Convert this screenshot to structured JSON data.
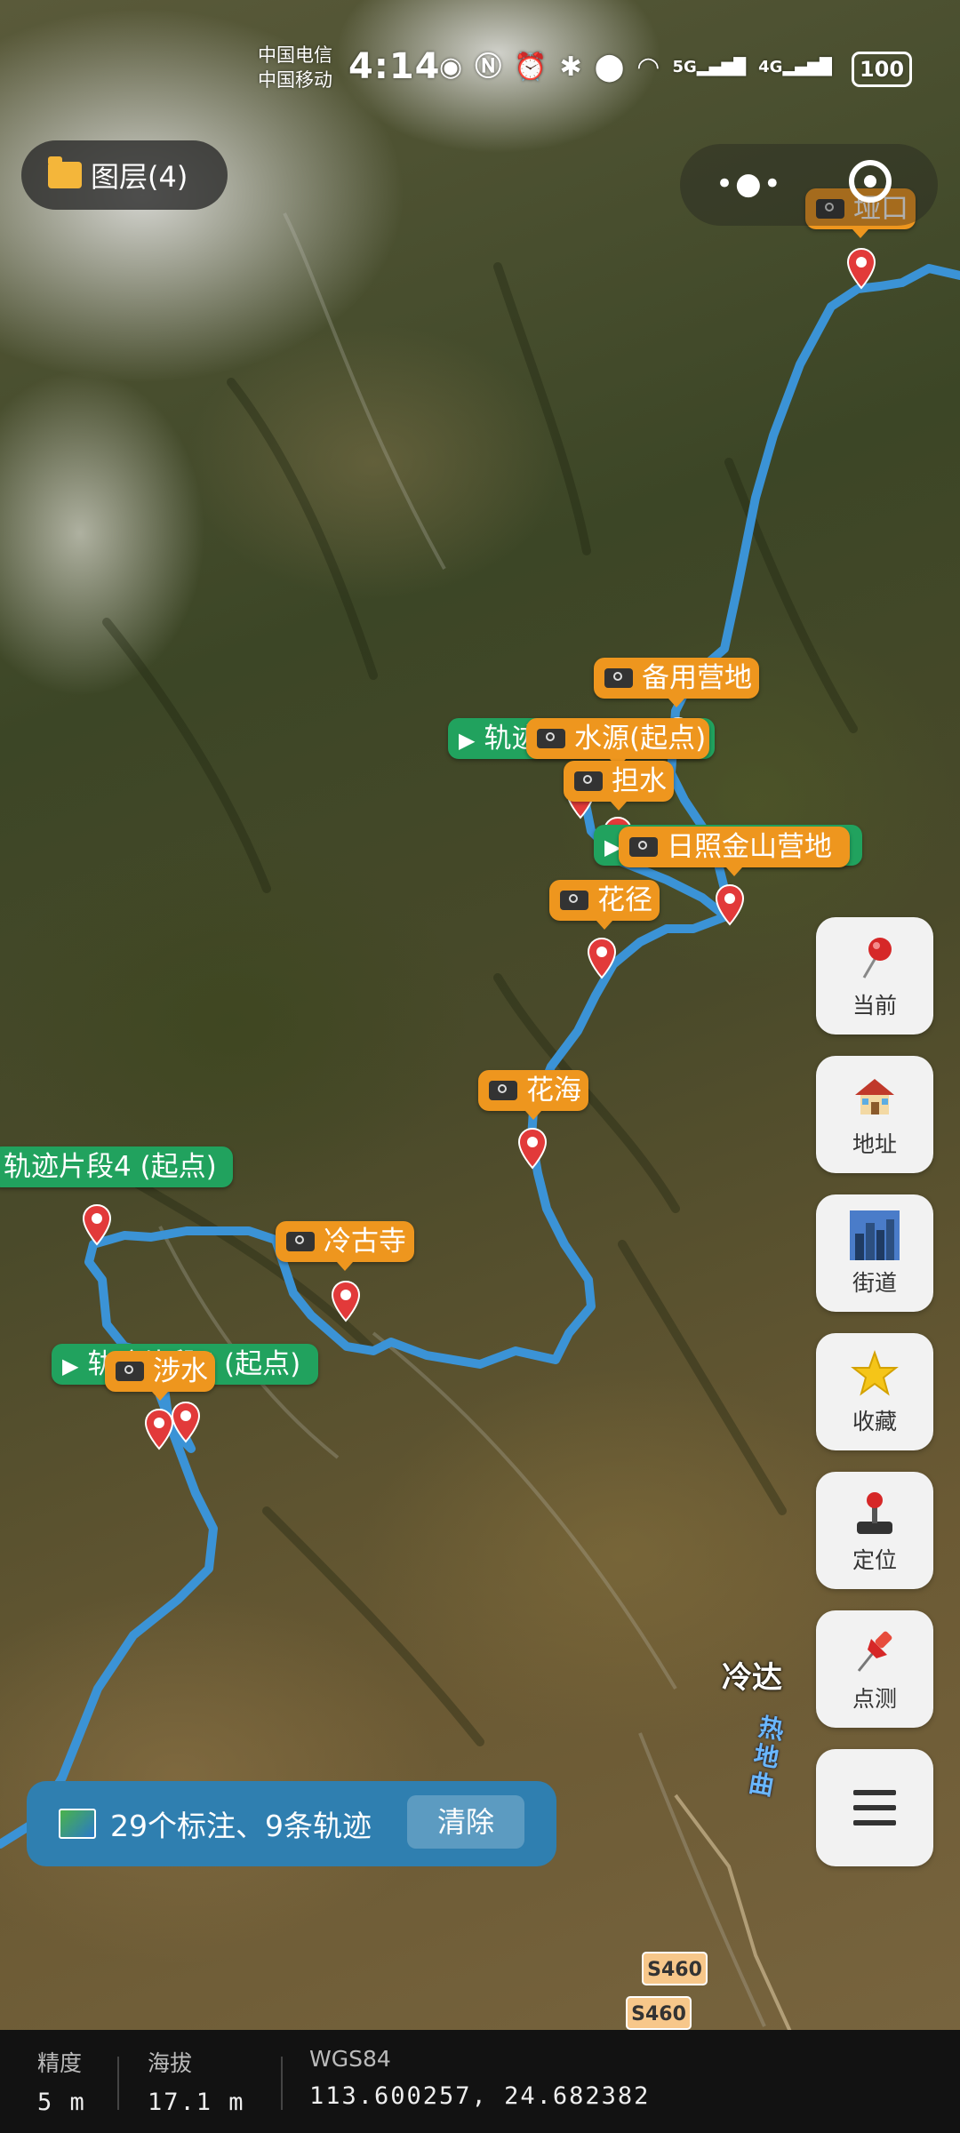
{
  "status_bar": {
    "carrier_1": "中国电信",
    "carrier_2": "中国移动",
    "time": "4:14",
    "network_1": "5G",
    "network_2": "4G",
    "battery": "100"
  },
  "layer_button": {
    "label": "图层(4)"
  },
  "map": {
    "labels": [
      {
        "id": "yakou",
        "text": "垭口",
        "type": "photo"
      },
      {
        "id": "beiyong",
        "text": "备用营地",
        "type": "photo"
      },
      {
        "id": "track_seg",
        "text": "轨迹",
        "type": "track"
      },
      {
        "id": "shuiyuan",
        "text": "水源(起点)",
        "type": "photo"
      },
      {
        "id": "danshui",
        "text": "担水",
        "type": "photo"
      },
      {
        "id": "rizhao",
        "text": "日照金山营地",
        "type": "photo"
      },
      {
        "id": "huajing",
        "text": "花径",
        "type": "photo"
      },
      {
        "id": "huahai",
        "text": "花海",
        "type": "photo"
      },
      {
        "id": "track4",
        "text": "轨迹片段4 (起点)",
        "type": "track"
      },
      {
        "id": "lenggusi",
        "text": "冷古寺",
        "type": "photo"
      },
      {
        "id": "track5",
        "text": "轨迹片段5 (起点)",
        "type": "track"
      },
      {
        "id": "sheshui",
        "text": "涉水",
        "type": "photo"
      }
    ],
    "place_name": "冷达",
    "river_name": "热地曲",
    "road_badges": [
      "S460",
      "S460"
    ]
  },
  "side_buttons": [
    {
      "id": "current",
      "label": "当前",
      "icon": "pushpin-icon"
    },
    {
      "id": "address",
      "label": "地址",
      "icon": "house-icon"
    },
    {
      "id": "street",
      "label": "街道",
      "icon": "cityscape-icon"
    },
    {
      "id": "favorite",
      "label": "收藏",
      "icon": "star-icon"
    },
    {
      "id": "locate",
      "label": "定位",
      "icon": "joystick-icon"
    },
    {
      "id": "measure",
      "label": "点测",
      "icon": "pin-icon"
    },
    {
      "id": "menu",
      "label": "",
      "icon": "menu-icon"
    }
  ],
  "info_bar": {
    "summary": "29个标注、9条轨迹",
    "clear_label": "清除"
  },
  "bottom_panel": {
    "accuracy_title": "精度",
    "accuracy_value": "5 m",
    "altitude_title": "海拔",
    "altitude_value": "17.1 m",
    "datum_title": "WGS84",
    "coords_value": "113.600257, 24.682382"
  },
  "colors": {
    "track": "#3b93d6",
    "photo_label": "#ee961e",
    "track_label": "#21a25e",
    "pin": "#e23a3a",
    "info_bar": "#2f7fb0"
  }
}
